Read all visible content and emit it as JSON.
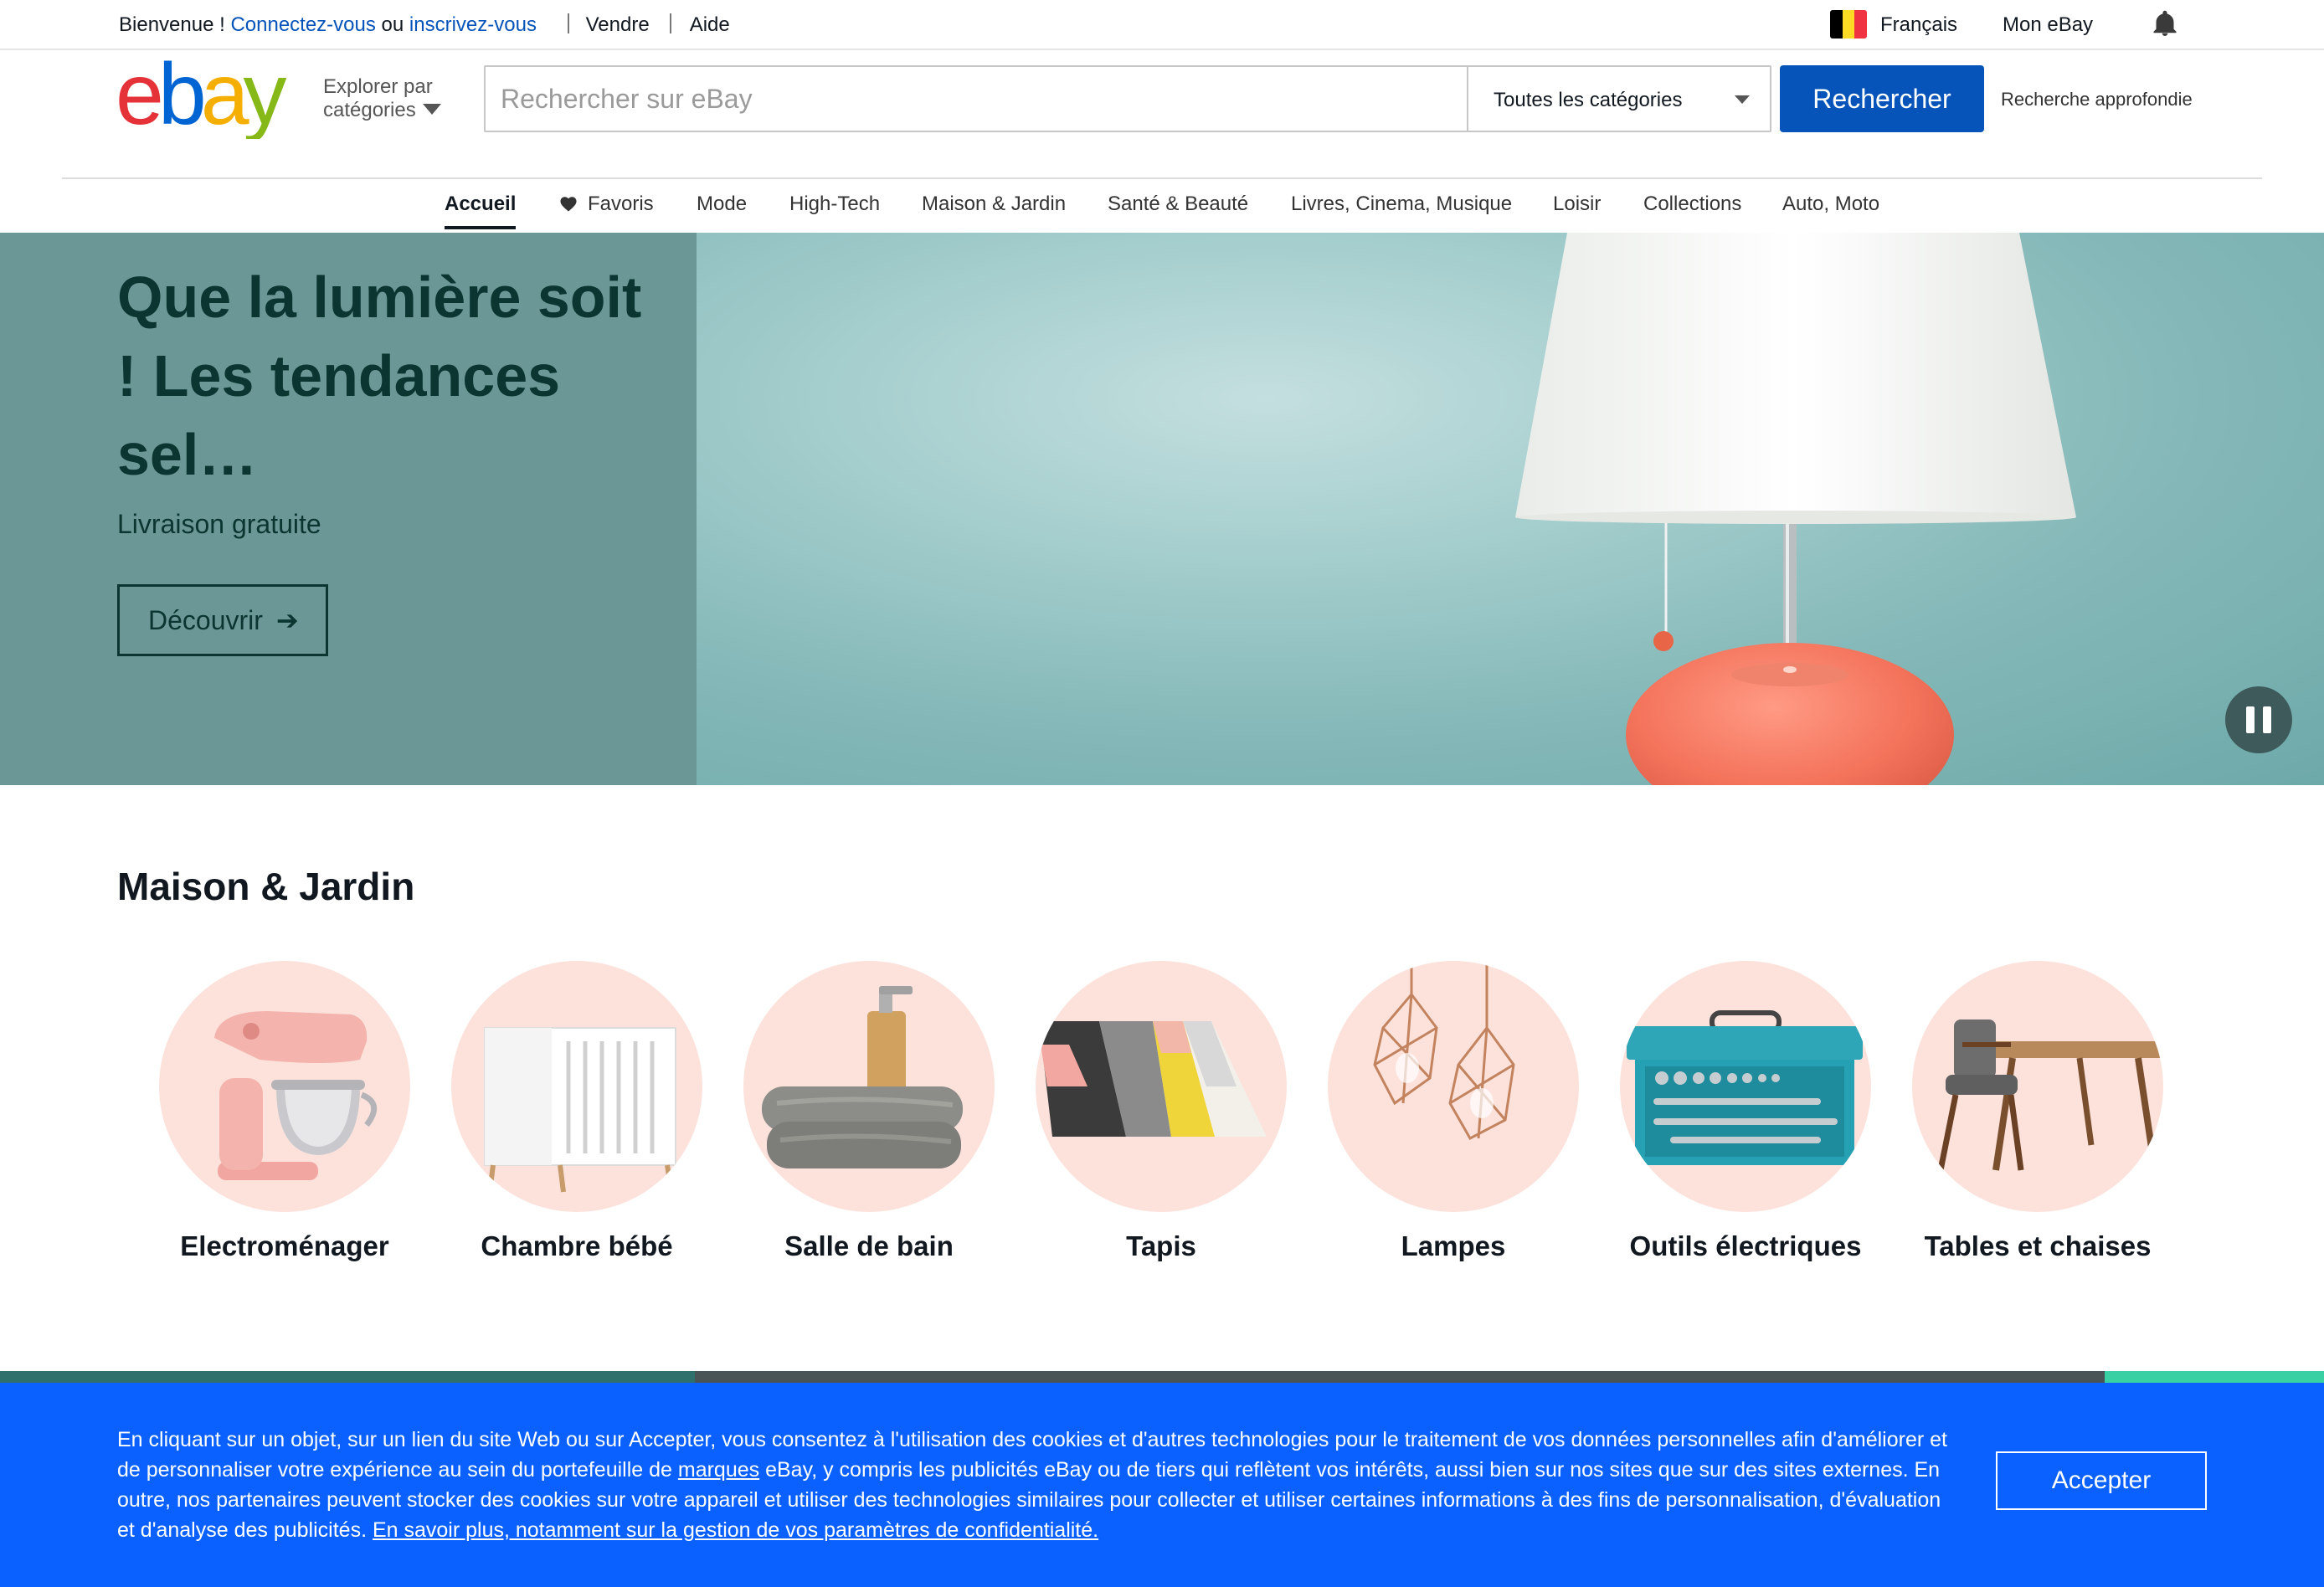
{
  "topbar": {
    "welcome": "Bienvenue ! ",
    "signin": "Connectez-vous",
    "or": " ou ",
    "register": "inscrivez-vous",
    "sell": "Vendre",
    "help": "Aide",
    "language": "Français",
    "my_ebay": "Mon eBay",
    "flag_colors": [
      "#000000",
      "#FDDA24",
      "#EF3340"
    ]
  },
  "header": {
    "logo_text": "ebay",
    "logo_colors": [
      "#e53238",
      "#0064d2",
      "#f5af02",
      "#86b817"
    ],
    "explore_line1": "Explorer par",
    "explore_line2": "catégories",
    "search_placeholder": "Rechercher sur eBay",
    "category_selected": "Toutes les catégories",
    "search_button": "Rechercher",
    "advanced": "Recherche approfondie"
  },
  "nav": {
    "items": [
      {
        "label": "Accueil",
        "active": true
      },
      {
        "label": "Favoris",
        "icon": "heart-icon"
      },
      {
        "label": "Mode"
      },
      {
        "label": "High-Tech"
      },
      {
        "label": "Maison & Jardin"
      },
      {
        "label": "Santé & Beauté"
      },
      {
        "label": "Livres, Cinema, Musique"
      },
      {
        "label": "Loisir"
      },
      {
        "label": "Collections"
      },
      {
        "label": "Auto, Moto"
      }
    ]
  },
  "hero": {
    "title": "Que la lumière soit ! Les tendances sel…",
    "subtitle": "Livraison gratuite",
    "cta": "Découvrir",
    "cta_arrow": "➔",
    "accent_color": "#0a3530"
  },
  "section": {
    "title": "Maison & Jardin",
    "tiles": [
      {
        "label": "Electroménager",
        "icon": "stand-mixer"
      },
      {
        "label": "Chambre bébé",
        "icon": "crib"
      },
      {
        "label": "Salle de bain",
        "icon": "towels-soap-dispenser"
      },
      {
        "label": "Tapis",
        "icon": "rug"
      },
      {
        "label": "Lampes",
        "icon": "pendant-lamps"
      },
      {
        "label": "Outils électriques",
        "icon": "toolbox"
      },
      {
        "label": "Tables et chaises",
        "icon": "table-chair"
      }
    ]
  },
  "cookie": {
    "text_1": "En cliquant sur un objet, sur un lien du site Web ou sur Accepter, vous consentez à l'utilisation des cookies et d'autres technologies pour le traitement de vos données personnelles afin d'améliorer et de personnaliser votre expérience au sein du portefeuille de ",
    "link_brands": "marques",
    "text_2": " eBay, y compris les publicités eBay ou de tiers qui reflètent vos intérêts, aussi bien sur nos sites que sur des sites externes. En outre, nos partenaires peuvent stocker des cookies sur votre appareil et utiliser des technologies similaires pour collecter et utiliser certaines informations à des fins de personnalisation, d'évaluation et d'analyse des publicités. ",
    "link_more": "En savoir plus, notamment sur la gestion de vos paramètres de confidentialité.",
    "accept": "Accepter",
    "background": "#0a61ff"
  }
}
